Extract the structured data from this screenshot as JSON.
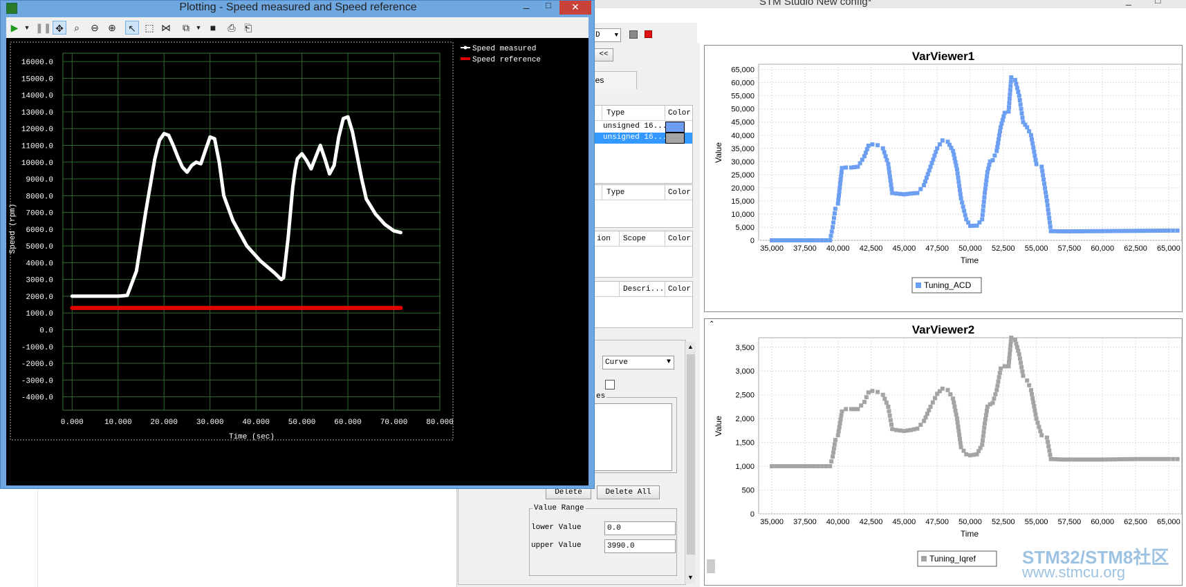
{
  "main_window": {
    "title": "STM Studio New config*",
    "combo_partial": "D",
    "collapse_button": "<<",
    "tab_partial": "les"
  },
  "variables_table": {
    "headers": [
      "Type",
      "Color"
    ],
    "rows": [
      {
        "type": "unsigned 16...",
        "color": "#6c9ff2"
      },
      {
        "type": "unsigned 16...",
        "color": "#a4a4a4"
      }
    ]
  },
  "table2": {
    "headers": [
      "Type",
      "Color"
    ]
  },
  "table3": {
    "headers": [
      "ion",
      "Scope",
      "Color"
    ]
  },
  "table4": {
    "headers": [
      "Descri...",
      "Color"
    ]
  },
  "settings": {
    "graph_type_value": "Curve",
    "group_legend_partial": "es",
    "delete_label": "Delete",
    "delete_all_label": "Delete All",
    "value_range_legend": "Value Range",
    "lower_label": "lower Value",
    "lower_value": "0.0",
    "upper_label": "upper Value",
    "upper_value": "3990.0"
  },
  "plot_window": {
    "title": "Plotting  - Speed measured and Speed reference",
    "toolbar_icons": [
      "play-icon",
      "dropdown-icon",
      "pause-icon",
      "pan-icon",
      "zoom-box-icon",
      "zoom-out-icon",
      "zoom-in-icon",
      "select-icon",
      "rect-select-icon",
      "split-icon",
      "copy-icon",
      "dropdown-icon",
      "save-icon",
      "print-icon",
      "print-preview-icon"
    ]
  },
  "charts": {
    "plot": {
      "xlabel": "Time (sec)",
      "ylabel": "Speed (rpm)",
      "xticks": [
        "0.000",
        "10.000",
        "20.000",
        "30.000",
        "40.000",
        "50.000",
        "60.000",
        "70.000",
        "80.000"
      ],
      "yticks": [
        "16000.0",
        "15000.0",
        "14000.0",
        "13000.0",
        "12000.0",
        "11000.0",
        "10000.0",
        "9000.0",
        "8000.0",
        "7000.0",
        "6000.0",
        "5000.0",
        "4000.0",
        "3000.0",
        "2000.0",
        "1000.0",
        "0.0",
        "-1000.0",
        "-2000.0",
        "-3000.0",
        "-4000.0"
      ],
      "legend": [
        "Speed measured",
        "Speed reference"
      ]
    },
    "viewer1": {
      "title": "VarViewer1",
      "xlabel": "Time",
      "ylabel": "Value",
      "xticks": [
        "35,000",
        "37,500",
        "40,000",
        "42,500",
        "45,000",
        "47,500",
        "50,000",
        "52,500",
        "55,000",
        "57,500",
        "60,000",
        "62,500",
        "65,000"
      ],
      "yticks": [
        "65,000",
        "60,000",
        "55,000",
        "50,000",
        "45,000",
        "40,000",
        "35,000",
        "30,000",
        "25,000",
        "20,000",
        "15,000",
        "10,000",
        "5,000",
        "0"
      ],
      "legend": "Tuning_ACD"
    },
    "viewer2": {
      "title": "VarViewer2",
      "xlabel": "Time",
      "ylabel": "Value",
      "xticks": [
        "35,000",
        "37,500",
        "40,000",
        "42,500",
        "45,000",
        "47,500",
        "50,000",
        "52,500",
        "55,000",
        "57,500",
        "60,000",
        "62,500",
        "65,000"
      ],
      "yticks": [
        "3,500",
        "3,000",
        "2,500",
        "2,000",
        "1,500",
        "1,000",
        "500",
        "0"
      ],
      "legend": "Tuning_Iqref"
    }
  },
  "chart_data": [
    {
      "type": "line",
      "x": [
        0,
        5,
        10,
        12,
        14,
        16,
        18,
        19,
        20,
        21,
        22,
        23,
        24,
        25,
        26,
        27,
        28,
        29,
        30,
        31,
        32,
        33,
        35,
        38,
        41,
        44,
        45.5,
        46,
        47,
        48,
        48.5,
        49,
        50,
        51,
        52,
        53,
        54,
        55,
        56,
        57,
        58,
        59,
        60,
        61,
        62,
        63,
        64,
        66,
        68,
        70,
        71.5
      ],
      "series": [
        {
          "name": "Speed measured",
          "values": [
            2000,
            2000,
            2000,
            2050,
            3500,
            7000,
            10200,
            11300,
            11700,
            11600,
            11000,
            10300,
            9700,
            9400,
            9800,
            10000,
            9900,
            10700,
            11500,
            11400,
            10000,
            8000,
            6500,
            5000,
            4100,
            3400,
            3000,
            3100,
            5500,
            8500,
            9500,
            10200,
            10500,
            10100,
            9600,
            10300,
            11000,
            10200,
            9300,
            9800,
            11500,
            12600,
            12700,
            11800,
            10400,
            9000,
            7800,
            6900,
            6300,
            5900,
            5800
          ]
        },
        {
          "name": "Speed reference",
          "values": [
            1300,
            1300,
            1300,
            1300,
            1300,
            1300,
            1300,
            1300,
            1300,
            1300,
            1300,
            1300,
            1300,
            1300,
            1300,
            1300,
            1300,
            1300,
            1300,
            1300,
            1300,
            1300,
            1300,
            1300,
            1300,
            1300,
            1300,
            1300,
            1300,
            1300,
            1300,
            1300,
            1300,
            1300,
            1300,
            1300,
            1300,
            1300,
            1300,
            1300,
            1300,
            1300,
            1300,
            1300,
            1300,
            1300,
            1300,
            1300,
            1300,
            1300,
            1300
          ]
        }
      ],
      "xlim": [
        -2,
        80
      ],
      "ylim": [
        -4800,
        16500
      ]
    },
    {
      "type": "scatter",
      "x": [
        35000,
        37500,
        39400,
        39600,
        39800,
        40000,
        40300,
        40600,
        41000,
        41500,
        42000,
        42300,
        42600,
        43000,
        43400,
        43800,
        44100,
        44400,
        45000,
        45500,
        46000,
        46500,
        47000,
        47500,
        47900,
        48300,
        48700,
        49000,
        49300,
        49700,
        50000,
        50500,
        50900,
        51100,
        51300,
        51500,
        51700,
        52000,
        52300,
        52600,
        52900,
        53100,
        53400,
        53700,
        54000,
        54300,
        54600,
        55000,
        55400,
        55800,
        56100,
        57000,
        60000,
        62500,
        65000,
        66000
      ],
      "series": [
        {
          "name": "Tuning_ACD",
          "values": [
            0,
            0,
            0,
            5000,
            12000,
            14000,
            27500,
            27700,
            27700,
            28000,
            32000,
            36000,
            36500,
            36200,
            35000,
            29000,
            18000,
            17800,
            17500,
            17800,
            18000,
            21000,
            28000,
            35000,
            38000,
            37500,
            34000,
            27000,
            16000,
            8000,
            5500,
            5600,
            8000,
            18000,
            26000,
            30000,
            30500,
            34000,
            43000,
            48500,
            49000,
            62000,
            61000,
            55000,
            45000,
            43000,
            40000,
            29000,
            28000,
            15000,
            3500,
            3400,
            3500,
            3600,
            3700,
            3700
          ]
        }
      ],
      "xlim": [
        34000,
        66000
      ],
      "ylim": [
        0,
        67000
      ]
    },
    {
      "type": "scatter",
      "x": [
        35000,
        37500,
        39400,
        39600,
        39800,
        40000,
        40300,
        40600,
        41000,
        41500,
        42000,
        42300,
        42600,
        43000,
        43400,
        43800,
        44100,
        44400,
        45000,
        45500,
        46000,
        46500,
        47000,
        47500,
        47900,
        48300,
        48700,
        49000,
        49300,
        49700,
        50000,
        50500,
        50900,
        51100,
        51300,
        51500,
        51700,
        52000,
        52300,
        52600,
        52900,
        53100,
        53400,
        53700,
        54000,
        54300,
        54600,
        55000,
        55400,
        55800,
        56100,
        57000,
        60000,
        62500,
        65000,
        66000
      ],
      "series": [
        {
          "name": "Tuning_Iqref",
          "values": [
            1000,
            1000,
            1000,
            1200,
            1550,
            1650,
            2150,
            2200,
            2200,
            2200,
            2350,
            2550,
            2580,
            2560,
            2500,
            2250,
            1780,
            1760,
            1740,
            1760,
            1790,
            1950,
            2250,
            2520,
            2630,
            2600,
            2420,
            2000,
            1400,
            1250,
            1230,
            1250,
            1450,
            1900,
            2250,
            2300,
            2330,
            2600,
            3050,
            3100,
            3100,
            3700,
            3650,
            3350,
            2900,
            2800,
            2600,
            2000,
            1650,
            1600,
            1150,
            1140,
            1140,
            1150,
            1150,
            1150
          ]
        }
      ],
      "xlim": [
        34000,
        66000
      ],
      "ylim": [
        0,
        3700
      ]
    }
  ]
}
